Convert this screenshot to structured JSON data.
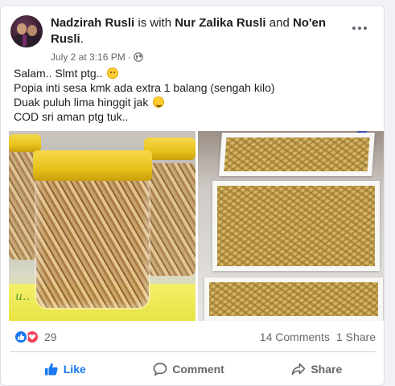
{
  "post": {
    "author": "Nadzirah Rusli",
    "with_text": "is with",
    "tagged_1": "Nur Zalika Rusli",
    "and_text": "and",
    "tagged_2": "No'en Rusli",
    "period": ".",
    "timestamp": "July 2 at 3:16 PM",
    "separator": "·",
    "privacy_icon": "globe-icon",
    "text_lines": [
      "Salam.. Slmt ptg..",
      "Popia inti sesa kmk ada extra 1 balang (sengah kilo)",
      "Duak puluh lima hinggit jak",
      "COD sri aman ptg tuk.."
    ],
    "photo_mat_text": "u.."
  },
  "stats": {
    "reaction_count": "29",
    "comments": "14 Comments",
    "shares": "1 Share"
  },
  "actions": {
    "like": "Like",
    "comment": "Comment",
    "share": "Share"
  },
  "colors": {
    "accent": "#1877f2",
    "love": "#f33e58",
    "text_secondary": "#65676b"
  }
}
